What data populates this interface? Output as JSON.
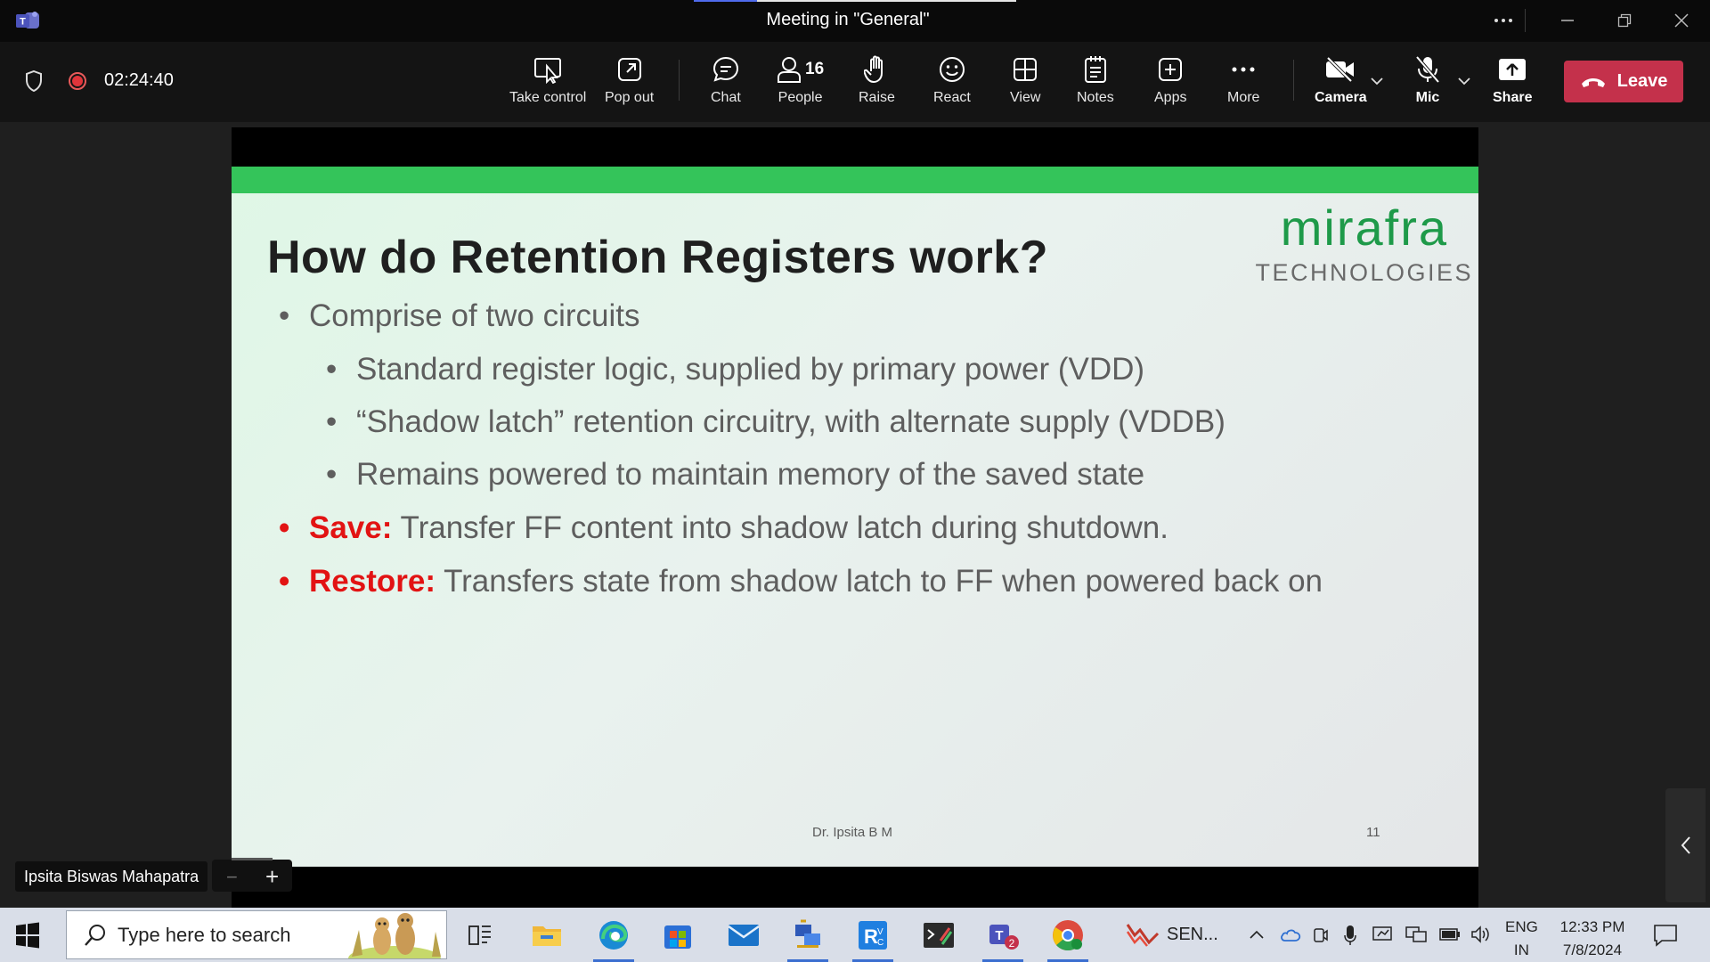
{
  "window": {
    "title": "Meeting in \"General\""
  },
  "meeting": {
    "timer": "02:24:40",
    "people_count": "16",
    "tools": {
      "take_control": "Take control",
      "pop_out": "Pop out",
      "chat": "Chat",
      "people": "People",
      "raise": "Raise",
      "react": "React",
      "view": "View",
      "notes": "Notes",
      "apps": "Apps",
      "more": "More",
      "camera": "Camera",
      "mic": "Mic",
      "share": "Share"
    },
    "leave_label": "Leave",
    "colors": {
      "leave": "#c4314b",
      "recording": "#e0353b"
    }
  },
  "slide": {
    "title": "How do Retention Registers work?",
    "logo_main": "mirafra",
    "logo_sub": "TECHNOLOGIES",
    "bullets": [
      {
        "text": "Comprise of two circuits"
      },
      {
        "text": "Standard register logic, supplied by primary power (VDD)"
      },
      {
        "text": "“Shadow latch” retention circuitry, with alternate supply (VDDB)"
      },
      {
        "text": "Remains powered to maintain memory of the saved state"
      },
      {
        "key": "Save:",
        "text": " Transfer FF content into shadow latch during shutdown."
      },
      {
        "key": "Restore:",
        "text": " Transfers state from shadow latch to FF when powered back on"
      }
    ],
    "author": "Dr. Ipsita B M",
    "page_number": "11",
    "colors": {
      "accent_bar": "#34c45a",
      "logo": "#1e9a49",
      "highlight": "#e21313"
    }
  },
  "presenter": {
    "name": "Ipsita Biswas Mahapatra"
  },
  "zoom": {
    "minus": "−",
    "plus": "+"
  },
  "taskbar": {
    "search_placeholder": "Type here to search",
    "running_label": "SEN...",
    "teams_badge": "2",
    "language": {
      "line1": "ENG",
      "line2": "IN"
    },
    "clock": {
      "time": "12:33 PM",
      "date": "7/8/2024"
    }
  }
}
